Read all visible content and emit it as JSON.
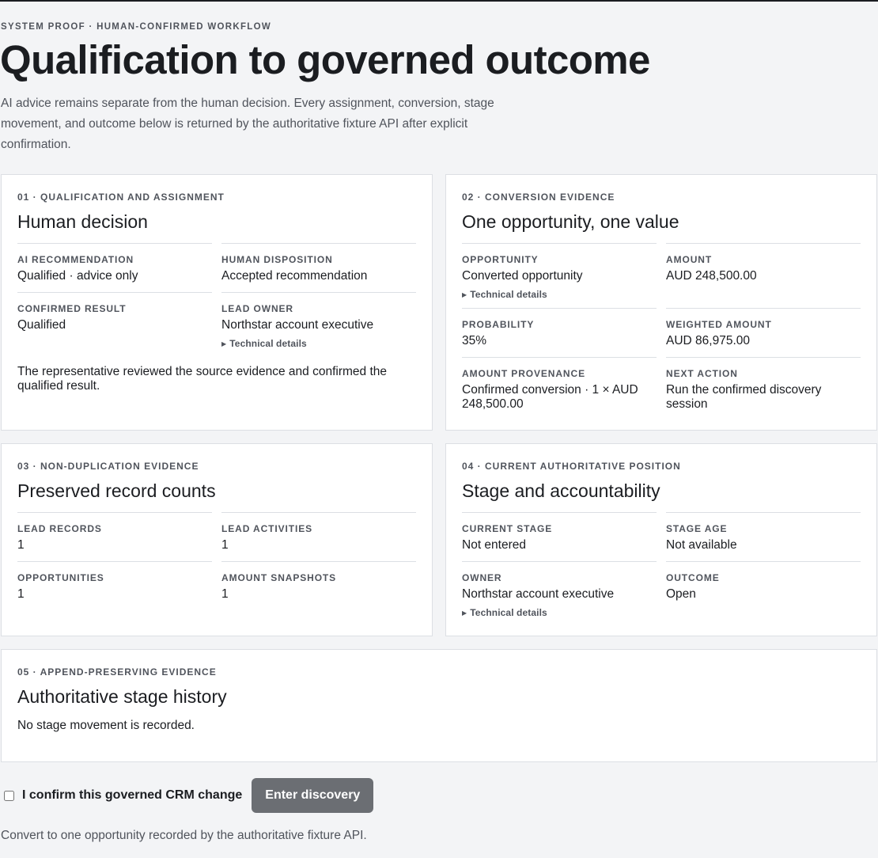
{
  "header": {
    "eyebrow": "SYSTEM PROOF · HUMAN-CONFIRMED WORKFLOW",
    "title": "Qualification to governed outcome",
    "intro": "AI advice remains separate from the human decision. Every assignment, conversion, stage movement, and outcome below is returned by the authoritative fixture API after explicit confirmation."
  },
  "technical_details_label": "Technical details",
  "card1": {
    "eyebrow": "01 · QUALIFICATION AND ASSIGNMENT",
    "title": "Human decision",
    "ai_recommendation": {
      "label": "AI RECOMMENDATION",
      "value": "Qualified · advice only"
    },
    "human_disposition": {
      "label": "HUMAN DISPOSITION",
      "value": "Accepted recommendation"
    },
    "confirmed_result": {
      "label": "CONFIRMED RESULT",
      "value": "Qualified"
    },
    "lead_owner": {
      "label": "LEAD OWNER",
      "value": "Northstar account executive"
    },
    "note": "The representative reviewed the source evidence and confirmed the qualified result."
  },
  "card2": {
    "eyebrow": "02 · CONVERSION EVIDENCE",
    "title": "One opportunity, one value",
    "opportunity": {
      "label": "OPPORTUNITY",
      "value": "Converted opportunity"
    },
    "amount": {
      "label": "AMOUNT",
      "value": "AUD 248,500.00"
    },
    "probability": {
      "label": "PROBABILITY",
      "value": "35%"
    },
    "weighted_amount": {
      "label": "WEIGHTED AMOUNT",
      "value": "AUD 86,975.00"
    },
    "amount_provenance": {
      "label": "AMOUNT PROVENANCE",
      "value": "Confirmed conversion · 1 × AUD 248,500.00"
    },
    "next_action": {
      "label": "NEXT ACTION",
      "value": "Run the confirmed discovery session"
    }
  },
  "card3": {
    "eyebrow": "03 · NON-DUPLICATION EVIDENCE",
    "title": "Preserved record counts",
    "lead_records": {
      "label": "LEAD RECORDS",
      "value": "1"
    },
    "lead_activities": {
      "label": "LEAD ACTIVITIES",
      "value": "1"
    },
    "opportunities": {
      "label": "OPPORTUNITIES",
      "value": "1"
    },
    "amount_snapshots": {
      "label": "AMOUNT SNAPSHOTS",
      "value": "1"
    }
  },
  "card4": {
    "eyebrow": "04 · CURRENT AUTHORITATIVE POSITION",
    "title": "Stage and accountability",
    "current_stage": {
      "label": "CURRENT STAGE",
      "value": "Not entered"
    },
    "stage_age": {
      "label": "STAGE AGE",
      "value": "Not available"
    },
    "owner": {
      "label": "OWNER",
      "value": "Northstar account executive"
    },
    "outcome": {
      "label": "OUTCOME",
      "value": "Open"
    }
  },
  "card5": {
    "eyebrow": "05 · APPEND-PRESERVING EVIDENCE",
    "title": "Authoritative stage history",
    "text": "No stage movement is recorded."
  },
  "confirm": {
    "checkbox_label": "I confirm this governed CRM change",
    "checked": false,
    "button_label": "Enter discovery"
  },
  "footer_note": "Convert to one opportunity recorded by the authoritative fixture API.",
  "colors": {
    "background": "#f3f4f6",
    "card": "#ffffff",
    "border": "#dcdfe4",
    "muted_text": "#50545c",
    "button_disabled": "#6b6e73"
  }
}
